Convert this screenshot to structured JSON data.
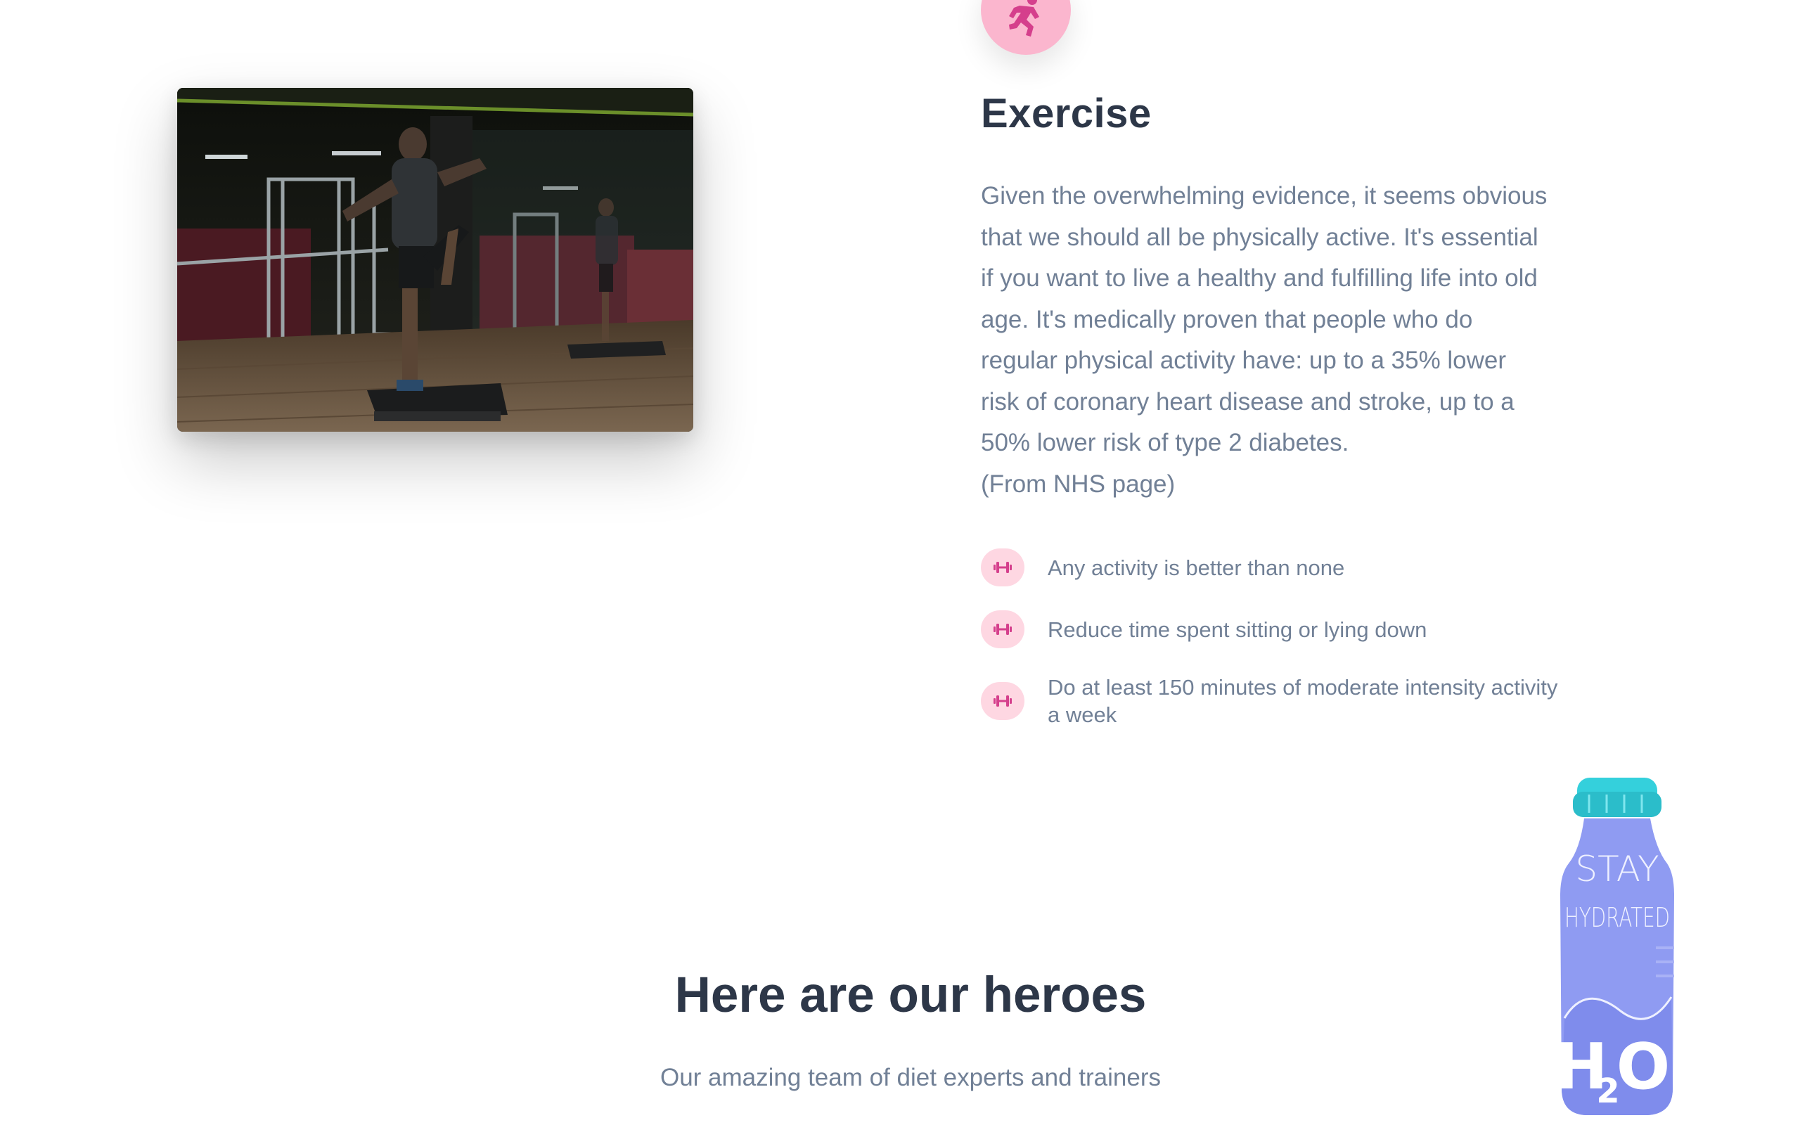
{
  "exercise": {
    "badge_icon": "running-person-icon",
    "title": "Exercise",
    "body_lines": [
      "Given the overwhelming evidence, it seems obvious",
      "that we should all be physically active. It's essential",
      "if you want to live a healthy and fulfilling life into old",
      "age. It's medically proven that people who do",
      "regular physical activity have: up to a 35% lower",
      "risk of coronary heart disease and stroke, up to a",
      "50% lower risk of type 2 diabetes.",
      "(From NHS page)"
    ],
    "tips": [
      {
        "icon": "dumbbell-icon",
        "text": "Any activity is better than none"
      },
      {
        "icon": "dumbbell-icon",
        "text": "Reduce time spent sitting or lying down"
      },
      {
        "icon": "dumbbell-icon",
        "text": "Do at least 150 minutes of moderate intensity activity a week"
      }
    ],
    "photo": "gym-step-training-photo"
  },
  "heroes": {
    "title": "Here are our heroes",
    "subtitle": "Our amazing team of diet experts and trainers"
  },
  "illustration": {
    "name": "water-bottle-illustration",
    "lines": [
      "STAY",
      "HYDRATED",
      "H",
      "2",
      "O"
    ]
  },
  "colors": {
    "heading": "#2d3748",
    "body": "#718096",
    "accent_pink": "#d53f8c",
    "badge_pink": "#fbb6ce",
    "tip_bg": "#fed7e2",
    "bottle": "#8f9bf2",
    "bottle_cap": "#34d0dc"
  }
}
